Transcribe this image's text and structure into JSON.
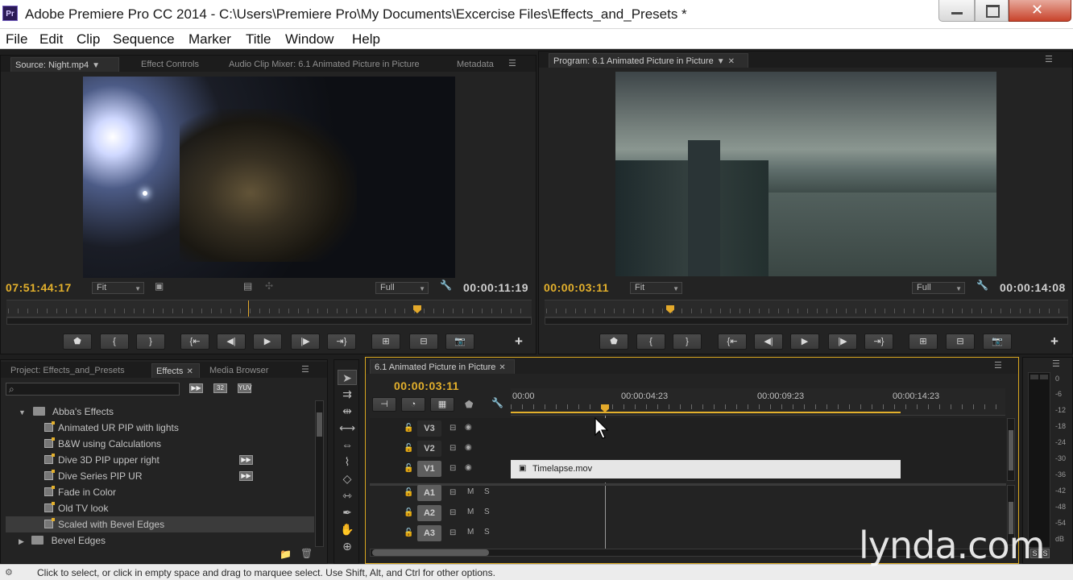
{
  "window": {
    "app_icon_text": "Pr",
    "title": "Adobe Premiere Pro CC 2014 - C:\\Users\\Premiere Pro\\My Documents\\Excercise Files\\Effects_and_Presets *"
  },
  "menu": [
    "File",
    "Edit",
    "Clip",
    "Sequence",
    "Marker",
    "Title",
    "Window",
    "Help"
  ],
  "source_monitor": {
    "tabs": [
      "Source: Night.mp4",
      "Effect Controls",
      "Audio Clip Mixer: 6.1 Animated Picture in Picture",
      "Metadata"
    ],
    "timecode_in": "07:51:44:17",
    "fit": "Fit",
    "quality": "Full",
    "duration": "00:00:11:19"
  },
  "program_monitor": {
    "tab": "Program: 6.1 Animated Picture in Picture",
    "timecode": "00:00:03:11",
    "fit": "Fit",
    "quality": "Full",
    "duration": "00:00:14:08"
  },
  "effects_panel": {
    "tabs": [
      "Project: Effects_and_Presets",
      "Effects",
      "Media Browser"
    ],
    "badge_32": "32",
    "badge_yuv": "YUV",
    "folder": "Abba's Effects",
    "items": [
      "Animated UR PIP with lights",
      "B&W using Calculations",
      "Dive 3D PIP upper right",
      "Dive Series PIP UR",
      "Fade in Color",
      "Old TV look",
      "Scaled with Bevel Edges"
    ],
    "next_folder": "Bevel Edges"
  },
  "timeline": {
    "tab": "6.1 Animated Picture in Picture",
    "timecode": "00:00:03:11",
    "ruler": [
      "00:00",
      "00:00:04:23",
      "00:00:09:23",
      "00:00:14:23"
    ],
    "video_tracks": [
      "V3",
      "V2",
      "V1"
    ],
    "audio_tracks": [
      "A1",
      "A2",
      "A3"
    ],
    "mute": "M",
    "solo": "S",
    "clip": "Timelapse.mov"
  },
  "meter": {
    "labels": [
      "0",
      "-6",
      "-12",
      "-18",
      "-24",
      "-30",
      "-36",
      "-42",
      "-48",
      "-54",
      "dB"
    ],
    "solo_left": "S",
    "solo_right": "S"
  },
  "status": "Click to select, or click in empty space and drag to marquee select. Use Shift, Alt, and Ctrl for other options.",
  "watermark": "lynda.com"
}
